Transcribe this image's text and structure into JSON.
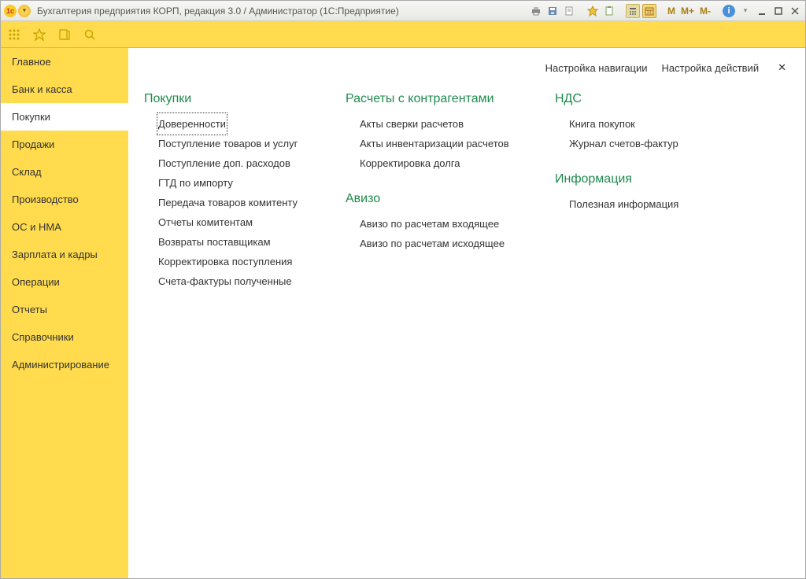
{
  "titlebar": {
    "title": "Бухгалтерия предприятия КОРП, редакция 3.0 / Администратор  (1С:Предприятие)"
  },
  "toolbar_m": {
    "m": "M",
    "mplus": "M+",
    "mminus": "M-"
  },
  "sidebar": {
    "items": [
      {
        "label": "Главное",
        "active": false
      },
      {
        "label": "Банк и касса",
        "active": false
      },
      {
        "label": "Покупки",
        "active": true
      },
      {
        "label": "Продажи",
        "active": false
      },
      {
        "label": "Склад",
        "active": false
      },
      {
        "label": "Производство",
        "active": false
      },
      {
        "label": "ОС и НМА",
        "active": false
      },
      {
        "label": "Зарплата и кадры",
        "active": false
      },
      {
        "label": "Операции",
        "active": false
      },
      {
        "label": "Отчеты",
        "active": false
      },
      {
        "label": "Справочники",
        "active": false
      },
      {
        "label": "Администрирование",
        "active": false
      }
    ]
  },
  "maintop": {
    "nav_setup": "Настройка навигации",
    "actions_setup": "Настройка действий"
  },
  "sections": {
    "purchases": {
      "title": "Покупки",
      "links": [
        "Доверенности",
        "Поступление товаров и услуг",
        "Поступление доп. расходов",
        "ГТД по импорту",
        "Передача товаров комитенту",
        "Отчеты комитентам",
        "Возвраты поставщикам",
        "Корректировка поступления",
        "Счета-фактуры полученные"
      ]
    },
    "settlements": {
      "title": "Расчеты с контрагентами",
      "links": [
        "Акты сверки расчетов",
        "Акты инвентаризации расчетов",
        "Корректировка долга"
      ]
    },
    "avizo": {
      "title": "Авизо",
      "links": [
        "Авизо по расчетам входящее",
        "Авизо по расчетам исходящее"
      ]
    },
    "nds": {
      "title": "НДС",
      "links": [
        "Книга покупок",
        "Журнал счетов-фактур"
      ]
    },
    "info": {
      "title": "Информация",
      "links": [
        "Полезная информация"
      ]
    }
  }
}
